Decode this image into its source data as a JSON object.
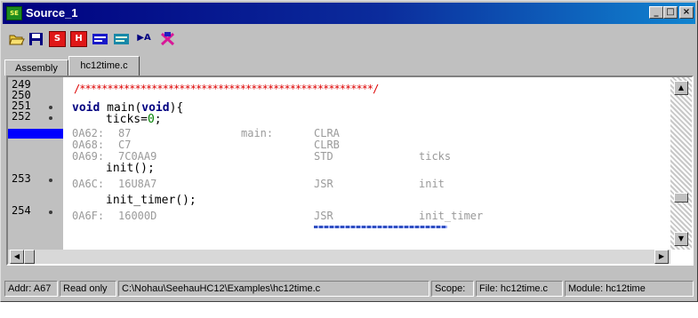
{
  "window": {
    "title": "Source_1",
    "app_icon": "source-window-icon",
    "controls": {
      "minimize": "_",
      "maximize": "□",
      "close": "×"
    }
  },
  "toolbar": {
    "items": [
      {
        "name": "open-folder-icon",
        "glyph": ""
      },
      {
        "name": "save-icon",
        "glyph": ""
      },
      {
        "name": "source-mode-icon",
        "glyph": "S"
      },
      {
        "name": "hex-mode-icon",
        "glyph": "H"
      },
      {
        "name": "step-source-icon",
        "glyph": ""
      },
      {
        "name": "step-assembly-icon",
        "glyph": ""
      },
      {
        "name": "run-to-cursor-icon",
        "glyph": "▶A"
      },
      {
        "name": "find-icon",
        "glyph": ""
      }
    ]
  },
  "tabs": [
    {
      "label": "Assembly",
      "active": false
    },
    {
      "label": "hc12time.c",
      "active": true
    }
  ],
  "gutter": {
    "line_numbers": [
      "249",
      "250",
      "251",
      "252",
      "253",
      "254"
    ],
    "breakpoint_rows": [
      "251",
      "252",
      "253",
      "254"
    ]
  },
  "code": {
    "comment_line": "/*****************************************************/",
    "main_decl": {
      "keyword1": "void",
      "name": " main(",
      "keyword2": "void",
      "rest": "){"
    },
    "ticks_line": {
      "text": "ticks=",
      "value": "0",
      "end": ";"
    },
    "init_line": "init();",
    "init_timer_line": "init_timer();",
    "asm": [
      {
        "addr": "0A62:",
        "bytes": "87",
        "label": "main:",
        "op": "CLRA",
        "arg": ""
      },
      {
        "addr": "0A68:",
        "bytes": "C7",
        "label": "",
        "op": "CLRB",
        "arg": ""
      },
      {
        "addr": "0A69:",
        "bytes": "7C0AA9",
        "label": "",
        "op": "STD",
        "arg": "ticks"
      },
      {
        "addr": "0A6C:",
        "bytes": "16U8A7",
        "label": "",
        "op": "JSR",
        "arg": "init"
      },
      {
        "addr": "0A6F:",
        "bytes": "16000D",
        "label": "",
        "op": "JSR",
        "arg": "init_timer"
      }
    ]
  },
  "status": {
    "addr": "Addr: A67",
    "mode": "Read only",
    "path": "C:\\Nohau\\SeehauHC12\\Examples\\hc12time.c",
    "scope": "Scope:",
    "file": "File: hc12time.c",
    "module": "Module: hc12time"
  }
}
